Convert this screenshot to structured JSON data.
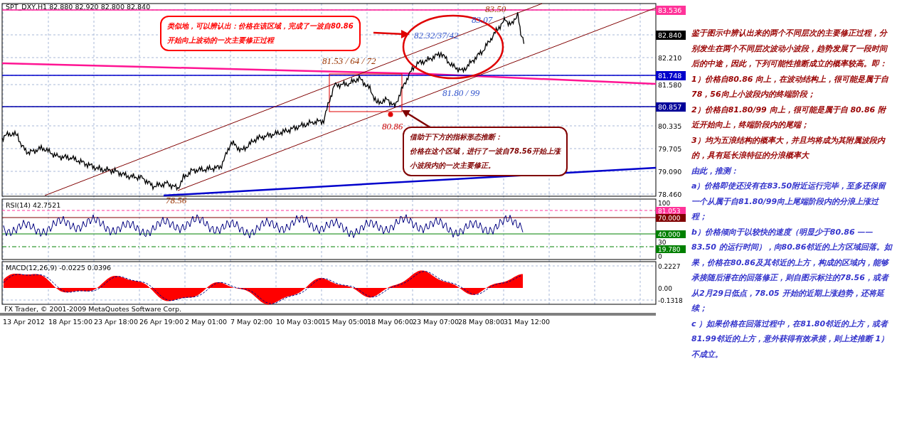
{
  "chart": {
    "title": "SPT_DXY,H1  82.880 82.920 82.800 82.840",
    "price_axis": [
      {
        "text": "83.536",
        "kind": "tag",
        "color": "#ff3399"
      },
      {
        "text": "82.840",
        "kind": "tag",
        "color": "#000000"
      },
      {
        "text": "82.210",
        "kind": "tick"
      },
      {
        "text": "81.748",
        "kind": "tag",
        "color": "#0000cc"
      },
      {
        "text": "81.580",
        "kind": "tick"
      },
      {
        "text": "80.857",
        "kind": "tag",
        "color": "#000099"
      },
      {
        "text": "80.335",
        "kind": "tick"
      },
      {
        "text": "79.705",
        "kind": "tick"
      },
      {
        "text": "79.090",
        "kind": "tick"
      },
      {
        "text": "78.460",
        "kind": "tick"
      }
    ],
    "labels": [
      {
        "text": "83.50",
        "color": "#993300"
      },
      {
        "text": "83.07",
        "color": "#3355cc"
      },
      {
        "text": "82.32/37/42",
        "color": "#3355cc"
      },
      {
        "text": "81.53 / 64 / 72",
        "color": "#993300"
      },
      {
        "text": "81.80 / 99",
        "color": "#3355cc"
      },
      {
        "text": "80.86",
        "color": "#cc0000"
      },
      {
        "text": "78.56",
        "color": "#993300"
      }
    ],
    "callouts": [
      {
        "lines": [
          "类似地，可以辨认出：价格在该区域，完成了一波自80.86",
          "开始向上波动的一次主要修正过程"
        ],
        "color": "#ff0000"
      },
      {
        "lines": [
          "借助于下方的指标形态推断：",
          "价格在这个区域，进行了一波自78.56开始上涨",
          "小波段内的一次主要修正。"
        ],
        "color": "#800000"
      }
    ],
    "rsi": {
      "title": "RSI(14) 42.7521",
      "axis": [
        {
          "text": "100",
          "kind": "tick"
        },
        {
          "text": "81.053",
          "kind": "tag",
          "color": "#ff3399"
        },
        {
          "text": "70.000",
          "kind": "tag",
          "color": "#800000"
        },
        {
          "text": "40.000",
          "kind": "tag",
          "color": "#008000"
        },
        {
          "text": "30",
          "kind": "tick"
        },
        {
          "text": "19.780",
          "kind": "tag",
          "color": "#008000"
        },
        {
          "text": "0",
          "kind": "tick"
        }
      ]
    },
    "macd": {
      "title": "MACD(12,26,9) -0.0225 0.0396",
      "axis": [
        {
          "text": "0.2227"
        },
        {
          "text": "0.00"
        },
        {
          "text": "-0.1318"
        }
      ]
    },
    "footer": "FX Trader, © 2001-2009 MetaQuotes Software Corp.",
    "time_axis": [
      "13 Apr 2012",
      "18 Apr 15:00",
      "23 Apr 18:00",
      "26 Apr 19:00",
      "2 May 01:00",
      "7 May 02:00",
      "10 May 03:00",
      "15 May 05:00",
      "18 May 06:00",
      "23 May 07:00",
      "28 May 08:00",
      "31 May 12:00"
    ]
  },
  "analysis": [
    {
      "text": "鉴于图示中辨认出来的两个不同层次的主要修正过程，分别发生在两个不同层次波动小波段，趋势发展了一段时间后的中途，因此，下列可能性推断成立的概率较高。即：",
      "color": "#990000"
    },
    {
      "text": "1）价格自80.86 向上，在波动结构上，很可能是属于自78，56向上小波段内的终端阶段；",
      "color": "#990000"
    },
    {
      "text": "2）价格自81.80/99 向上，很可能是属于自 80.86 附近开始向上，终端阶段内的尾端；",
      "color": "#990000"
    },
    {
      "text": "3）均为五浪结构的概率大，并且均将成为其附属波段内的，具有延长浪特征的分浪概率大",
      "color": "#990000"
    },
    {
      "text": "由此，推测：",
      "color": "#3333cc"
    },
    {
      "text": "a）价格即使还没有在83.50附近运行完毕，至多还保留一个从属于自81.80/99向上尾端阶段内的分浪上涨过程；",
      "color": "#3333cc"
    },
    {
      "text": "b）价格倾向于以较快的速度（明显少于80.86 —— 83.50 的运行时间），向80.86邻近的上方区域回落。如果，价格在80.86及其邻近的上方，构成的区域内，能够承接随后潜在的回落修正，则自图示标注的78.56，或者从2月29日低点，78.05 开始的近期上涨趋势，还将延续；",
      "color": "#3333cc"
    },
    {
      "text": "c ）如果价格在回落过程中，在81.80邻近的上方，或者81.99邻近的上方，意外获得有效承接，则上述推断 1）不成立。",
      "color": "#3333cc"
    }
  ]
}
